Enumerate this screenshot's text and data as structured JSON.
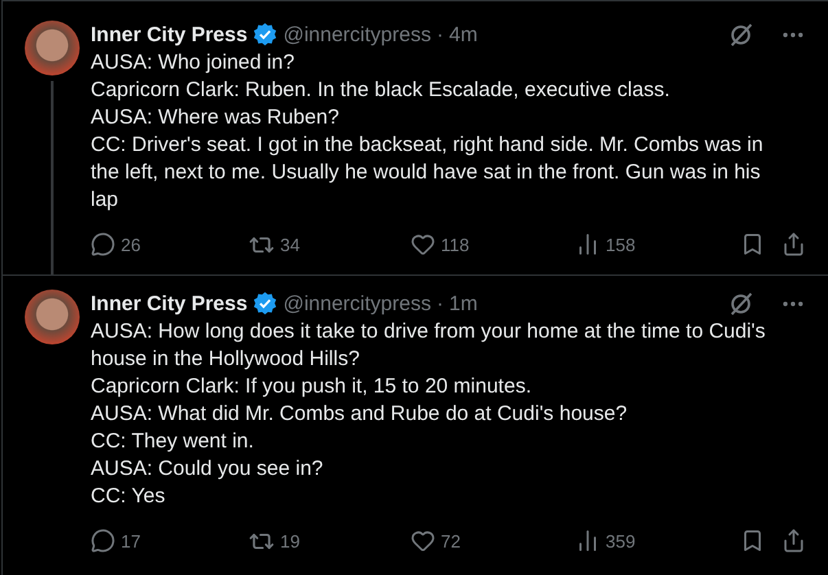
{
  "tweets": [
    {
      "name": "Inner City Press",
      "verified": true,
      "handle": "@innercitypress",
      "separator": "·",
      "time": "4m",
      "thread_continues": true,
      "text": "AUSA: Who joined in?\nCapricorn Clark: Ruben. In the black Escalade, executive class.\nAUSA: Where was Ruben?\nCC: Driver's seat. I got in the backseat, right hand side. Mr. Combs was in the left, next to me. Usually he would have sat in the front. Gun was in his lap",
      "replies": "26",
      "reposts": "34",
      "likes": "118",
      "views": "158"
    },
    {
      "name": "Inner City Press",
      "verified": true,
      "handle": "@innercitypress",
      "separator": "·",
      "time": "1m",
      "thread_continues": false,
      "text": "AUSA: How long does it take to drive from your home at the time to Cudi's house in the Hollywood Hills?\nCapricorn Clark: If you push it, 15 to 20 minutes.\nAUSA: What did Mr. Combs and Rube do at Cudi's house?\nCC: They went in.\nAUSA: Could you see in?\nCC: Yes",
      "replies": "17",
      "reposts": "19",
      "likes": "72",
      "views": "359"
    }
  ]
}
